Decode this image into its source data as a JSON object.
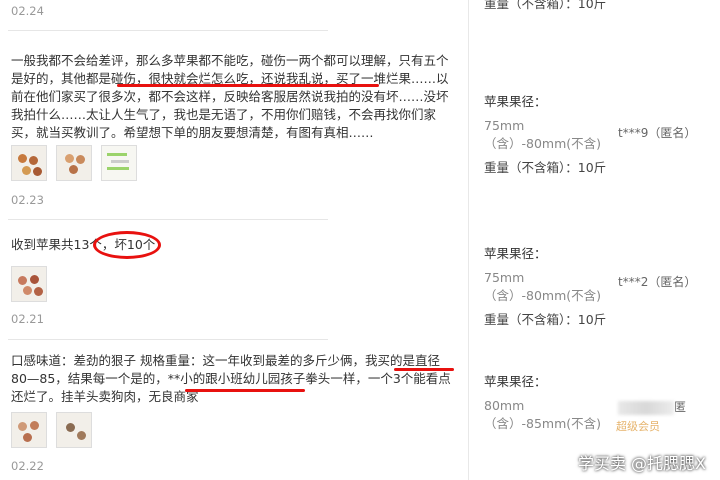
{
  "reviews": [
    {
      "date": "02.24",
      "weight_label": "重量（不含箱）：",
      "weight_value": "10斤"
    },
    {
      "text": "一般我都不会给差评，那么多苹果都不能吃，碰伤一两个都可以理解，只有五个是好的，其他都是碰伤，很快就会烂怎么吃，还说我乱说，买了一堆烂果……以前在他们家买了很多次，都不会这样，反映给客服居然说我拍的没有坏……没坏我拍什么……太让人生气了，我也是无语了，不用你们赔钱，不会再找你们家买，就当买教训了。希望想下单的朋友要想清楚，有图有真相……",
      "date": "02.23",
      "spec_label": "苹果果径：",
      "spec_value": "75mm（含）-80mm(不含)",
      "weight_label": "重量（不含箱）：",
      "weight_value": "10斤",
      "buyer": "t***9（匿名）"
    },
    {
      "text": "收到苹果共13个，坏10个",
      "date": "02.21",
      "spec_label": "苹果果径：",
      "spec_value": "75mm（含）-80mm(不含)",
      "weight_label": "重量（不含箱）：",
      "weight_value": "10斤",
      "buyer": "t***2（匿名）"
    },
    {
      "text": "口感味道：差劲的狠子 规格重量：这一年收到最差的多斤少俩，我买的是直径80—85，结果每一个是的，**小的跟小班幼儿园孩子拳头一样，一个3个能看点还烂了。挂羊头卖狗肉，无良商家",
      "date": "02.22",
      "spec_label": "苹果果径：",
      "spec_value": "80mm（含）-85mm(不含)",
      "buyer_suffix": "匿",
      "badge": "超级会员"
    }
  ],
  "watermark": "学买卖 @托腮腮X",
  "colors": {
    "annotation": "#e8110f",
    "date": "#999999",
    "badge": "#e6b36b"
  }
}
